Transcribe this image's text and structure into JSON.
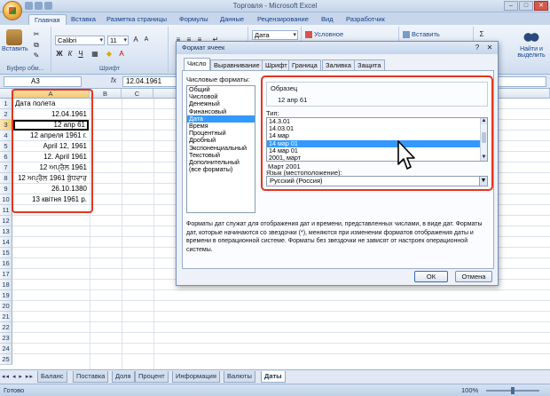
{
  "window": {
    "title": "Торговля - Microsoft Excel",
    "controls": [
      "–",
      "□",
      "✕"
    ]
  },
  "ribbon_tabs": [
    "Главная",
    "Вставка",
    "Разметка страницы",
    "Формулы",
    "Данные",
    "Рецензирование",
    "Вид",
    "Разработчик"
  ],
  "ribbon": {
    "clipboard": {
      "paste": "Вставить",
      "label": "Буфер обм..."
    },
    "font": {
      "name": "Calibri",
      "size": "11",
      "label": "Шрифт",
      "bold": "Ж",
      "italic": "К",
      "underline": "Ч"
    },
    "number": {
      "format": "Дата"
    },
    "styles": {
      "conditional": "Условное форматирование"
    },
    "cells": {
      "insert": "Вставить"
    },
    "editing": {
      "find": "Найти и выделить"
    }
  },
  "formula_bar": {
    "name_box": "A3",
    "fx": "fx",
    "formula": "12.04.1961"
  },
  "grid": {
    "columns": [
      "A",
      "B",
      "C"
    ],
    "rows": [
      "1",
      "2",
      "3",
      "4",
      "5",
      "6",
      "7",
      "8",
      "9",
      "10",
      "11",
      "12",
      "13",
      "14",
      "15",
      "16",
      "17",
      "18",
      "19",
      "20",
      "21",
      "22",
      "23",
      "24",
      "25"
    ],
    "cells": [
      "Дата полета",
      "12.04.1961",
      "12 апр 61",
      "12 апреля 1961 г.",
      "April 12, 1961",
      "12. April 1961",
      "12 ਅਪ੍ਰੈਲ 1961",
      "12 ਅਪ੍ਰੈਲ 1961 ਬੁੱਧਵਾਰ",
      "26.10.1380",
      "13 квітня 1961 р."
    ]
  },
  "sheet_tabs": [
    "Баланс",
    "Поставка",
    "Доля",
    "Процент",
    "Информация",
    "Валюты",
    "Даты"
  ],
  "status": {
    "ready": "Готово",
    "zoom": "100%"
  },
  "dialog": {
    "title": "Формат ячеек",
    "help": "?",
    "close": "✕",
    "tabs": [
      "Число",
      "Выравнивание",
      "Шрифт",
      "Граница",
      "Заливка",
      "Защита"
    ],
    "categories_label": "Числовые форматы:",
    "categories": [
      "Общий",
      "Числовой",
      "Денежный",
      "Финансовый",
      "Дата",
      "Время",
      "Процентный",
      "Дробный",
      "Экспоненциальный",
      "Текстовый",
      "Дополнительный",
      "(все форматы)"
    ],
    "sample_label": "Образец",
    "sample_value": "12 апр 61",
    "type_label": "Тип:",
    "types": [
      "14.3.01",
      "14.03.01",
      "14 мар",
      "14 мар 01",
      "14 мар 01",
      "2001, март",
      "Март 2001"
    ],
    "language_label": "Язык (местоположение):",
    "language": "Русский (Россия)",
    "description": "Форматы дат служат для отображения дат и времени, представленных числами, в виде дат. Форматы дат, которые начинаются со звездочки (*), меняются при изменении форматов отображения даты и времени в операционной системе. Форматы без звездочки не зависят от настроек операционной системы.",
    "ok": "ОК",
    "cancel": "Отмена"
  },
  "colors": {
    "highlight": "#e8351e",
    "selection": "#3399ff"
  }
}
